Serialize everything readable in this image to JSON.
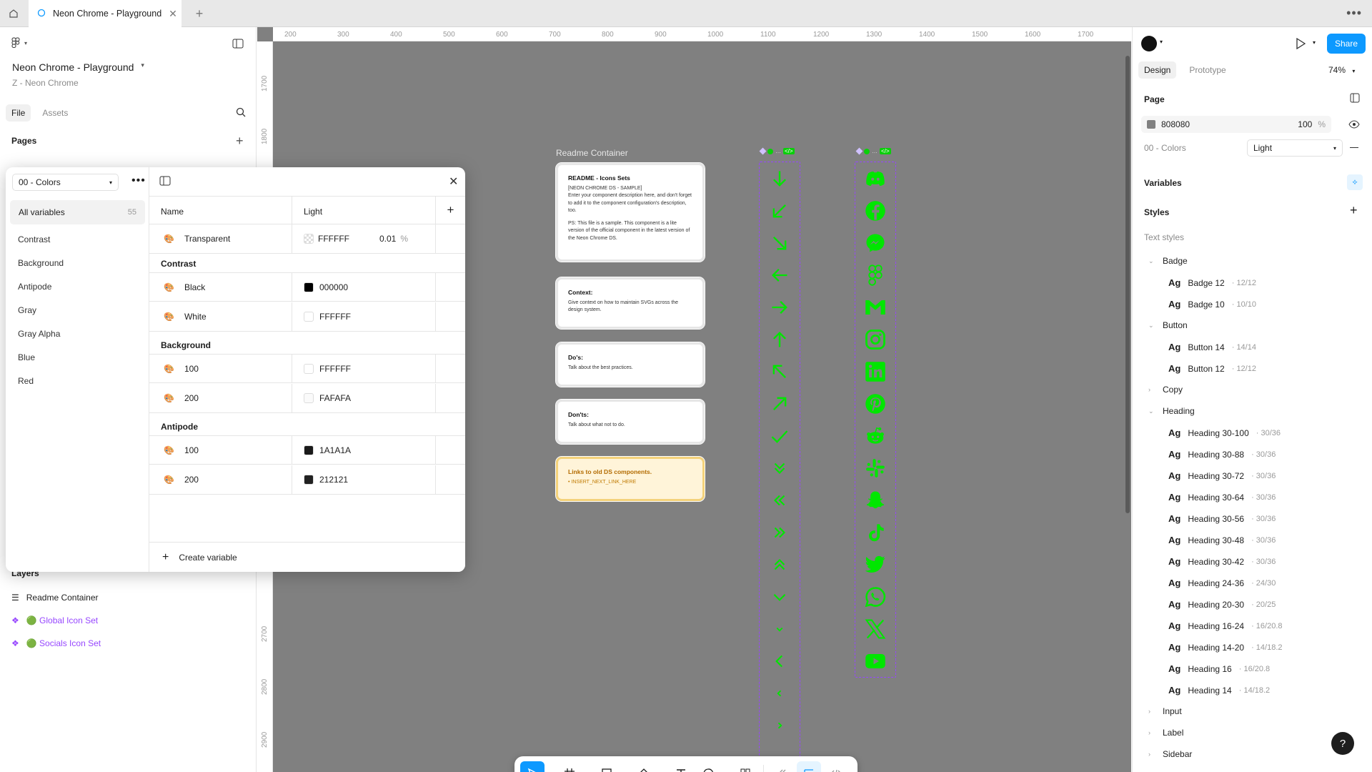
{
  "tabbar": {
    "doc_tab": "Neon Chrome - Playground"
  },
  "left": {
    "file_title": "Neon Chrome - Playground",
    "file_sub": "Z - Neon Chrome",
    "tabs": [
      "File",
      "Assets"
    ],
    "pages_label": "Pages",
    "layers_label": "Layers",
    "layers": [
      "Readme Container",
      "🟢 Global Icon Set",
      "🟢 Socials Icon Set"
    ]
  },
  "modal": {
    "collection": "00 - Colors",
    "all_variables": "All variables",
    "all_count": "55",
    "groups": [
      "Contrast",
      "Background",
      "Antipode",
      "Gray",
      "Gray Alpha",
      "Blue",
      "Red"
    ],
    "col_name": "Name",
    "col_mode": "Light",
    "rows": {
      "transparent": {
        "name": "Transparent",
        "value": "FFFFFF",
        "alpha": "0.01",
        "unit": "%"
      },
      "contrast_title": "Contrast",
      "black": {
        "name": "Black",
        "value": "000000"
      },
      "white": {
        "name": "White",
        "value": "FFFFFF"
      },
      "background_title": "Background",
      "bg100": {
        "name": "100",
        "value": "FFFFFF"
      },
      "bg200": {
        "name": "200",
        "value": "FAFAFA"
      },
      "antipode_title": "Antipode",
      "ap100": {
        "name": "100",
        "value": "1A1A1A"
      },
      "ap200": {
        "name": "200",
        "value": "212121"
      }
    },
    "create_variable": "Create variable"
  },
  "canvas": {
    "ruler_top": [
      "200",
      "300",
      "400",
      "500",
      "600",
      "700",
      "800",
      "900",
      "1000",
      "1100",
      "1200",
      "1300",
      "1400",
      "1500",
      "1600",
      "1700"
    ],
    "ruler_left": [
      "1700",
      "1800",
      "2700",
      "2800",
      "2900"
    ],
    "readme_label": "Readme Container",
    "cards": {
      "readme_title": "README - Icons Sets",
      "readme_body1": "[NEON CHROME DS - SAMPLE]\nEnter your component description here, and don't forget to add it to the component configuration's description, too.",
      "readme_body2": "PS: This file is a sample. This component is a lite version of the official component in the latest version of the Neon Chrome DS.",
      "context_title": "Context:",
      "context_body": "Give context on how to maintain SVGs across the design system.",
      "dos_title": "Do's:",
      "dos_body": "Talk about the best practices.",
      "donts_title": "Don'ts:",
      "donts_body": "Talk about what not to do.",
      "links_title": "Links to old DS components.",
      "links_body": "• INSERT_NEXT_LINK_HERE"
    },
    "neon_color": "#00e600"
  },
  "right": {
    "share": "Share",
    "tabs": [
      "Design",
      "Prototype"
    ],
    "zoom": "74%",
    "page_label": "Page",
    "page_color": "808080",
    "page_opacity": "100",
    "page_opacity_unit": "%",
    "page_mode_label": "00 - Colors",
    "page_mode": "Light",
    "variables_label": "Variables",
    "styles_label": "Styles",
    "text_styles_label": "Text styles",
    "style_groups": {
      "badge": "Badge",
      "button": "Button",
      "copy": "Copy",
      "heading": "Heading",
      "input": "Input",
      "label": "Label",
      "sidebar": "Sidebar"
    },
    "styles": [
      {
        "name": "Badge 12",
        "meta": "· 12/12"
      },
      {
        "name": "Badge 10",
        "meta": "· 10/10"
      },
      {
        "name": "Button 14",
        "meta": "· 14/14"
      },
      {
        "name": "Button 12",
        "meta": "· 12/12"
      },
      {
        "name": "Heading 30-100",
        "meta": "· 30/36"
      },
      {
        "name": "Heading 30-88",
        "meta": "· 30/36"
      },
      {
        "name": "Heading 30-72",
        "meta": "· 30/36"
      },
      {
        "name": "Heading 30-64",
        "meta": "· 30/36"
      },
      {
        "name": "Heading 30-56",
        "meta": "· 30/36"
      },
      {
        "name": "Heading 30-48",
        "meta": "· 30/36"
      },
      {
        "name": "Heading 30-42",
        "meta": "· 30/36"
      },
      {
        "name": "Heading 24-36",
        "meta": "· 24/30"
      },
      {
        "name": "Heading 20-30",
        "meta": "· 20/25"
      },
      {
        "name": "Heading 16-24",
        "meta": "· 16/20.8"
      },
      {
        "name": "Heading 14-20",
        "meta": "· 14/18.2"
      },
      {
        "name": "Heading 16",
        "meta": "· 16/20.8"
      },
      {
        "name": "Heading 14",
        "meta": "· 14/18.2"
      }
    ],
    "ag": "Ag",
    "help": "?"
  }
}
